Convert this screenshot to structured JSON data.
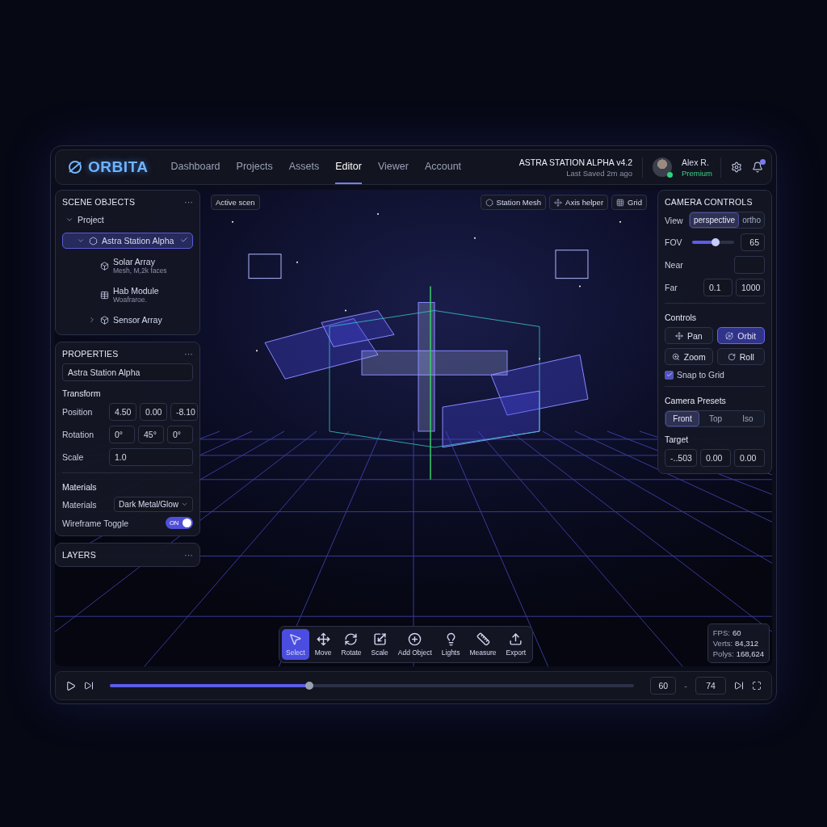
{
  "header": {
    "logo": "ORBITA",
    "nav": [
      {
        "label": "Dashboard",
        "selected": false
      },
      {
        "label": "Projects",
        "selected": false
      },
      {
        "label": "Assets",
        "selected": false
      },
      {
        "label": "Editor",
        "selected": true
      },
      {
        "label": "Viewer",
        "selected": false
      },
      {
        "label": "Account",
        "selected": false
      }
    ],
    "project_title": "ASTRA STATION ALPHA v4.2",
    "last_saved": "Last Saved 2m ago",
    "user": {
      "name": "Alex R.",
      "plan": "Premium",
      "online": true
    },
    "notifications": true
  },
  "scene_objects": {
    "title": "SCENE OBJECTS",
    "menu": "···",
    "tree": [
      {
        "label": "Project",
        "expanded": true,
        "selected": false,
        "children": [
          {
            "label": "Astra Station Alpha",
            "expanded": true,
            "selected": true,
            "children": [
              {
                "label": "Solar Array",
                "subtitle": "Mesh, M,2k faces",
                "selected": false
              },
              {
                "label": "Hab Module",
                "subtitle": "Woafraroe.",
                "selected": false
              },
              {
                "label": "Sensor Array",
                "expanded": false,
                "selected": false
              }
            ]
          }
        ]
      }
    ]
  },
  "properties": {
    "title": "PROPERTIES",
    "menu": "···",
    "name": "Astra Station Alpha",
    "transform_heading": "Transform",
    "rows": [
      {
        "label": "Position",
        "values": [
          "4.50",
          "0.00",
          "-8.10"
        ]
      },
      {
        "label": "Rotation",
        "values": [
          "0°",
          "45°",
          "0°"
        ]
      },
      {
        "label": "Scale",
        "values": [
          "1.0"
        ]
      }
    ],
    "materials_heading": "Materials",
    "material": {
      "label": "Materials",
      "value": "Dark Metal/Glow"
    },
    "wireframe": {
      "label": "Wireframe Toggle",
      "on": true,
      "text": "ON"
    }
  },
  "layers": {
    "title": "LAYERS",
    "menu": "···"
  },
  "viewport": {
    "scene_chip": "Active scen",
    "chips": [
      "Station Mesh",
      "Axis helper",
      "Grid"
    ]
  },
  "camera": {
    "title": "CAMERA CONTROLS",
    "view_label": "View",
    "views": [
      {
        "label": "perspective",
        "selected": true
      },
      {
        "label": "ortho",
        "selected": false
      }
    ],
    "fov": {
      "label": "FOV",
      "level": 0.55,
      "value": "65"
    },
    "near": {
      "label": "Near"
    },
    "far": {
      "label": "Far",
      "values": [
        "0.1",
        "1000"
      ]
    },
    "controls_heading": "Controls",
    "controls": [
      {
        "label": "Pan",
        "selected": false
      },
      {
        "label": "Orbit",
        "selected": true
      },
      {
        "label": "Zoom",
        "selected": false
      },
      {
        "label": "Roll",
        "selected": false
      }
    ],
    "snap": {
      "label": "Snap to Grid",
      "checked": true
    },
    "presets_heading": "Camera Presets",
    "presets": [
      {
        "label": "Front",
        "selected": true
      },
      {
        "label": "Top",
        "selected": false
      },
      {
        "label": "Iso",
        "selected": false
      }
    ],
    "target_heading": "Target",
    "target": [
      "-..503",
      "0.00",
      "0.00"
    ]
  },
  "toolbar": [
    {
      "label": "Select",
      "selected": true
    },
    {
      "label": "Move",
      "selected": false
    },
    {
      "label": "Rotate",
      "selected": false
    },
    {
      "label": "Scale",
      "selected": false
    },
    {
      "label": "Add Object",
      "selected": false
    },
    {
      "label": "Lights",
      "selected": false
    },
    {
      "label": "Measure",
      "selected": false
    },
    {
      "label": "Export",
      "selected": false
    }
  ],
  "stats": [
    {
      "label": "FPS:",
      "value": "60"
    },
    {
      "label": "Verts:",
      "value": "84,312"
    },
    {
      "label": "Polys:",
      "value": "168,624"
    }
  ],
  "timeline": {
    "level": 0.38,
    "frame": "60",
    "separator": "-",
    "end": "74"
  }
}
